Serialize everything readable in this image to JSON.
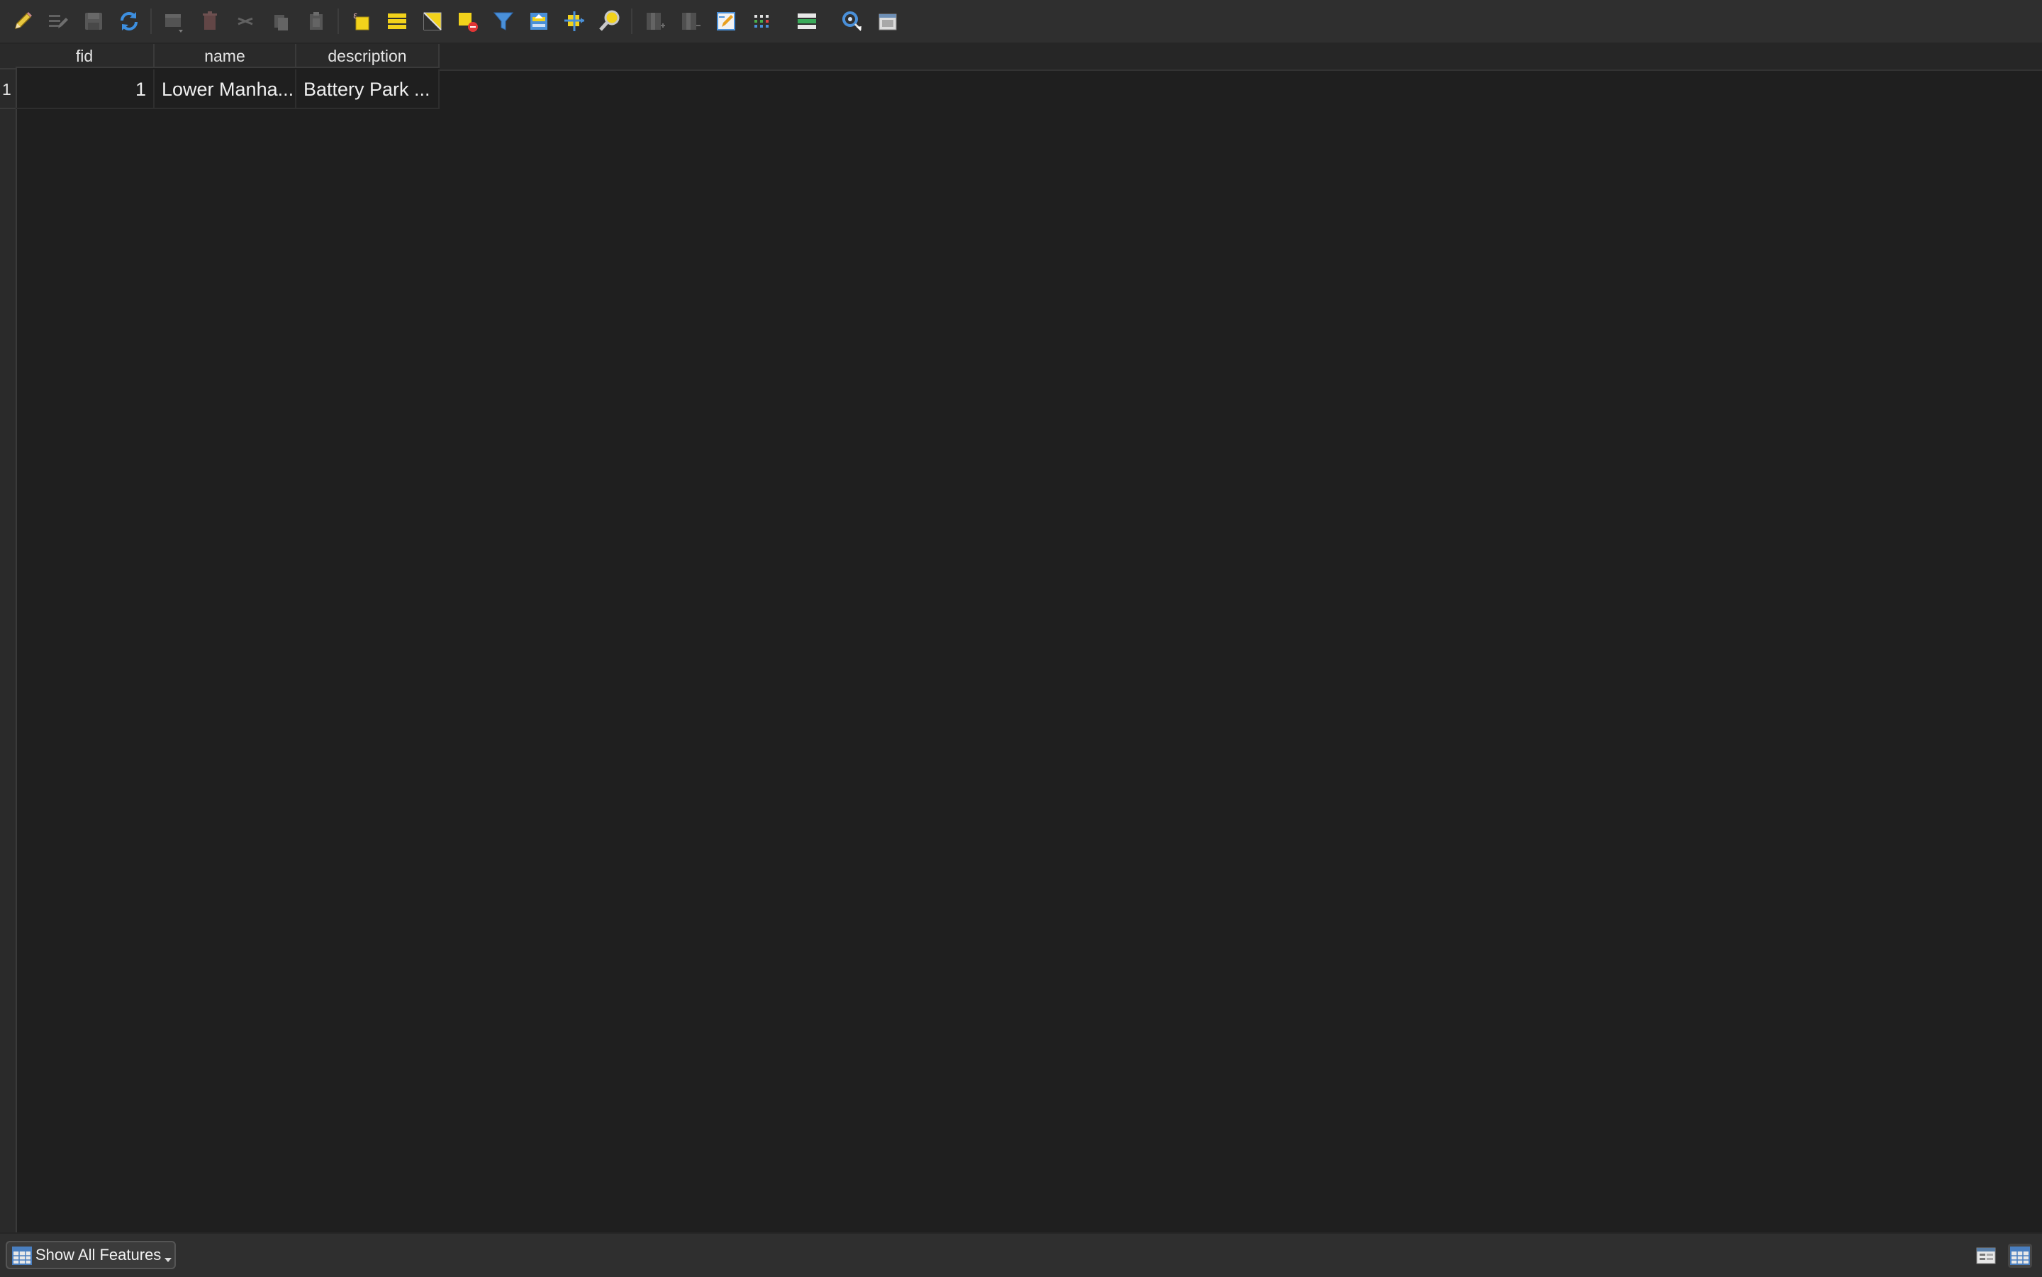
{
  "toolbar": {
    "icons": [
      {
        "name": "toggle-editing-icon",
        "enabled": true
      },
      {
        "name": "multi-edit-icon",
        "enabled": false
      },
      {
        "name": "save-edits-icon",
        "enabled": false
      },
      {
        "name": "reload-icon",
        "enabled": true
      },
      {
        "name": "add-feature-icon",
        "enabled": false
      },
      {
        "name": "delete-feature-icon",
        "enabled": false
      },
      {
        "name": "cut-icon",
        "enabled": false
      },
      {
        "name": "copy-icon",
        "enabled": false
      },
      {
        "name": "paste-icon",
        "enabled": false
      },
      {
        "name": "select-by-expression-icon",
        "enabled": true
      },
      {
        "name": "select-all-icon",
        "enabled": true
      },
      {
        "name": "invert-selection-icon",
        "enabled": true
      },
      {
        "name": "deselect-all-icon",
        "enabled": true
      },
      {
        "name": "filter-select-icon",
        "enabled": true
      },
      {
        "name": "move-selection-to-top-icon",
        "enabled": true
      },
      {
        "name": "pan-to-selection-icon",
        "enabled": true
      },
      {
        "name": "zoom-to-selection-icon",
        "enabled": true
      },
      {
        "name": "new-field-icon",
        "enabled": false
      },
      {
        "name": "delete-field-icon",
        "enabled": false
      },
      {
        "name": "field-calculator-icon",
        "enabled": true
      },
      {
        "name": "conditional-formatting-icon",
        "enabled": true
      },
      {
        "name": "actions-icon",
        "enabled": true
      },
      {
        "name": "identify-icon",
        "enabled": true
      },
      {
        "name": "dock-window-icon",
        "enabled": true
      }
    ]
  },
  "table": {
    "columns": [
      "fid",
      "name",
      "description"
    ],
    "rows": [
      {
        "row_header": "1",
        "cells": [
          "1",
          "Lower Manha...",
          "Battery Park ..."
        ]
      }
    ]
  },
  "statusbar": {
    "filter_label": "Show All Features",
    "filter_icon": "table-icon",
    "form_view_icon": "form-view-icon",
    "table_view_icon": "table-view-icon"
  }
}
